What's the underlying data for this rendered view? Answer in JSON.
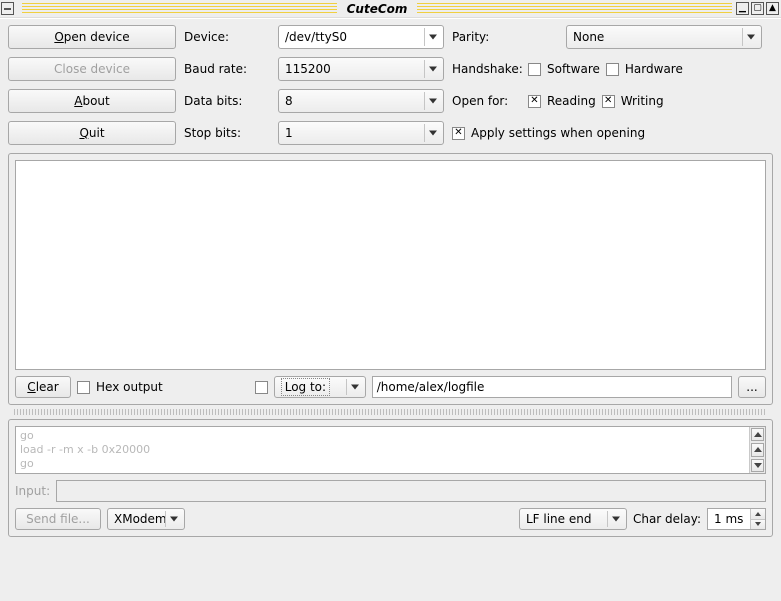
{
  "title": "CuteCom",
  "buttons": {
    "open": "Open device",
    "close": "Close device",
    "about": "About",
    "quit": "Quit",
    "clear": "Clear",
    "browse": "...",
    "sendfile": "Send file..."
  },
  "labels": {
    "device": "Device:",
    "baud": "Baud rate:",
    "databits": "Data bits:",
    "stopbits": "Stop bits:",
    "parity": "Parity:",
    "handshake": "Handshake:",
    "software": "Software",
    "hardware": "Hardware",
    "openfor": "Open for:",
    "reading": "Reading",
    "writing": "Writing",
    "apply": "Apply settings when opening",
    "hexout": "Hex output",
    "logto": "Log to:",
    "input": "Input:",
    "chardelay": "Char delay:"
  },
  "values": {
    "device": "/dev/ttyS0",
    "baud": "115200",
    "databits": "8",
    "stopbits": "1",
    "parity": "None",
    "logpath": "/home/alex/logfile",
    "protocol": "XModem",
    "lineend": "LF line end",
    "chardelay": "1 ms"
  },
  "checks": {
    "software": false,
    "hardware": false,
    "reading": true,
    "writing": true,
    "apply": true,
    "hexout": false,
    "log": false
  },
  "history": [
    "go",
    "load -r -m x -b 0x20000",
    "go"
  ]
}
